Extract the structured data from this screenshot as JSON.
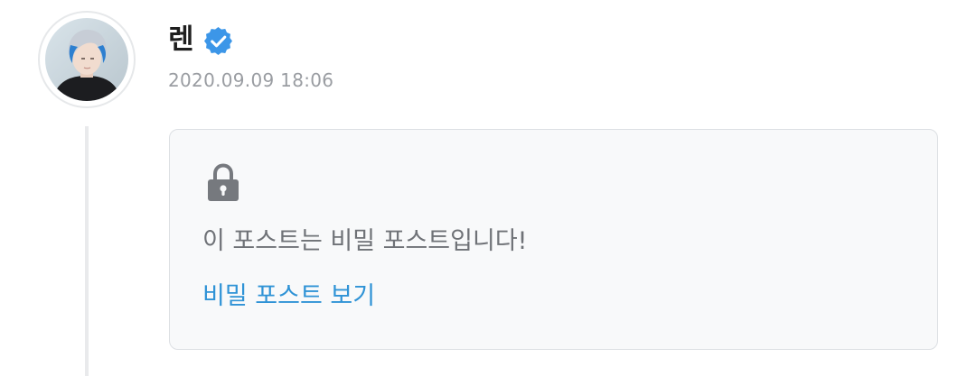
{
  "post": {
    "author": {
      "name": "렌",
      "verified": true,
      "verified_icon": "verified-badge-icon"
    },
    "timestamp": "2020.09.09 18:06"
  },
  "secret_post": {
    "icon": "lock-icon",
    "message": "이 포스트는 비밀 포스트입니다!",
    "view_link_label": "비밀 포스트 보기"
  },
  "colors": {
    "link": "#2f93d6",
    "verified_badge": "#3c96e8",
    "lock": "#76797e",
    "card_background": "#f8f9fa",
    "muted_text": "#9a9da2"
  }
}
